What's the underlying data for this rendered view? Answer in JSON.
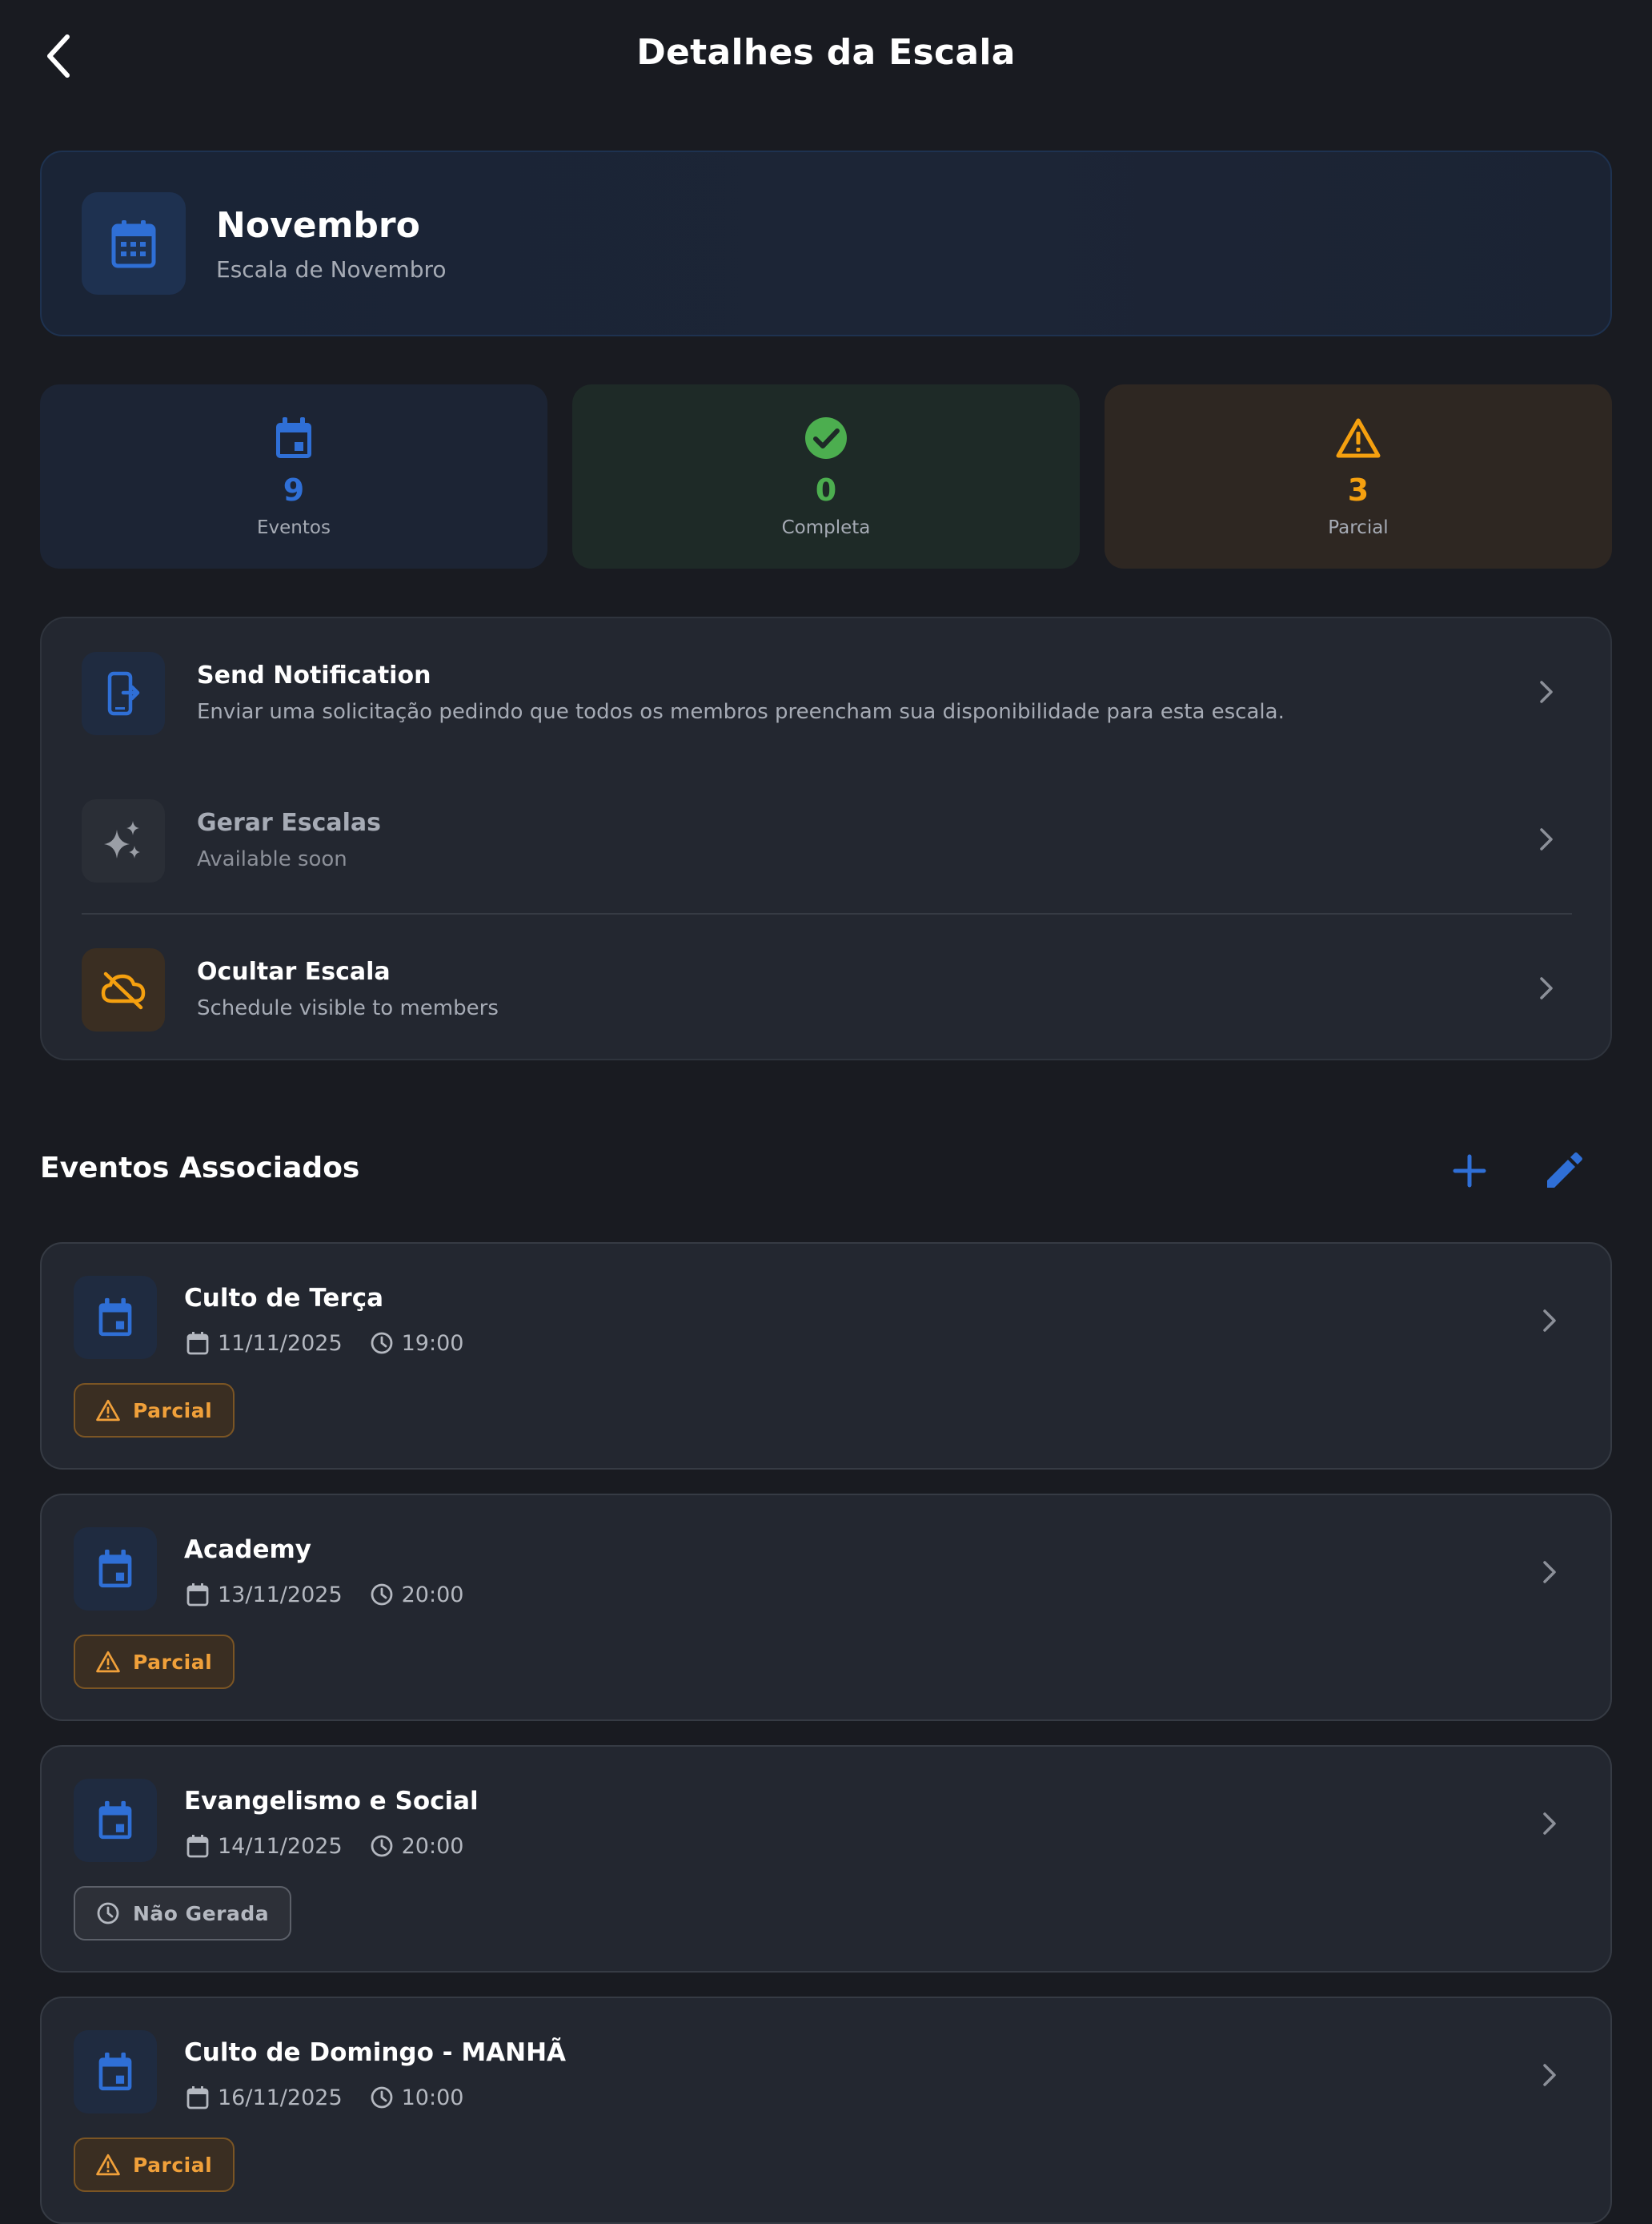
{
  "header": {
    "title": "Detalhes da Escala",
    "back_icon": "chevron-left-icon"
  },
  "schedule": {
    "title": "Novembro",
    "subtitle": "Escala de Novembro",
    "icon": "calendar-icon"
  },
  "stats": [
    {
      "value": "9",
      "label": "Eventos",
      "icon": "calendar-icon",
      "color": "#2f6fd6",
      "bg": "#1c2434"
    },
    {
      "value": "0",
      "label": "Completa",
      "icon": "check-circle-icon",
      "color": "#4cae4f",
      "bg": "#1e2a27"
    },
    {
      "value": "3",
      "label": "Parcial",
      "icon": "warning-icon",
      "color": "#f5a00f",
      "bg": "#2e2722"
    }
  ],
  "actions": [
    {
      "title": "Send Notification",
      "description": "Enviar uma solicitação pedindo que todos os membros preencham sua disponibilidade para esta escala.",
      "icon": "phone-forward-icon"
    },
    {
      "title": "Gerar Escalas",
      "description": "Available soon",
      "icon": "sparkles-icon"
    },
    {
      "title": "Ocultar Escala",
      "description": "Schedule visible to members",
      "icon": "cloud-off-icon"
    }
  ],
  "events_section": {
    "title": "Eventos Associados",
    "add_icon": "plus-icon",
    "edit_icon": "pencil-icon"
  },
  "events": [
    {
      "title": "Culto de Terça",
      "date": "11/11/2025",
      "time": "19:00",
      "status": "Parcial",
      "status_type": "parcial"
    },
    {
      "title": "Academy",
      "date": "13/11/2025",
      "time": "20:00",
      "status": "Parcial",
      "status_type": "parcial"
    },
    {
      "title": "Evangelismo e Social",
      "date": "14/11/2025",
      "time": "20:00",
      "status": "Não Gerada",
      "status_type": "nao"
    },
    {
      "title": "Culto de Domingo - MANHÃ",
      "date": "16/11/2025",
      "time": "10:00",
      "status": "Parcial",
      "status_type": "parcial"
    }
  ]
}
